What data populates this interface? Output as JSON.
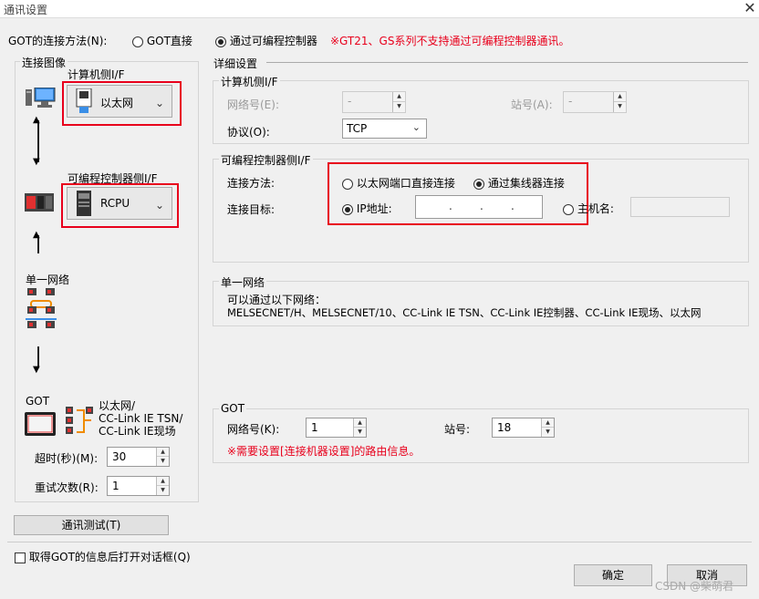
{
  "window": {
    "title": "通讯设置"
  },
  "top": {
    "connection_method_label": "GOT的连接方法(N):",
    "option_direct": "GOT直接",
    "option_plc": "通过可编程控制器",
    "warning": "※GT21、GS系列不支持通过可编程控制器通讯。"
  },
  "left": {
    "image_group": "连接图像",
    "pc_if_label": "计算机侧I/F",
    "pc_if_value": "以太网",
    "plc_if_label": "可编程控制器侧I/F",
    "plc_if_value": "RCPU",
    "network_label": "单一网络",
    "got_label": "GOT",
    "got_net_text": "以太网/\nCC-Link IE TSN/\nCC-Link IE现场",
    "timeout_label": "超时(秒)(M):",
    "timeout_value": "30",
    "retry_label": "重试次数(R):",
    "retry_value": "1",
    "test_button": "通讯测试(T)"
  },
  "detail": {
    "title": "详细设置",
    "pc_if": {
      "title": "计算机侧I/F",
      "network_no_label": "网络号(E):",
      "network_no_value": "-",
      "station_label": "站号(A):",
      "station_value": "-",
      "protocol_label": "协议(O):",
      "protocol_value": "TCP"
    },
    "plc_if": {
      "title": "可编程控制器侧I/F",
      "method_label": "连接方法:",
      "method_direct": "以太网端口直接连接",
      "method_hub": "通过集线器连接",
      "target_label": "连接目标:",
      "ip_label": "IP地址:",
      "host_label": "主机名:"
    },
    "network": {
      "title": "单一网络",
      "desc": "可以通过以下网络：",
      "list": "MELSECNET/H、MELSECNET/10、CC-Link IE TSN、CC-Link IE控制器、CC-Link IE现场、以太网"
    },
    "got": {
      "title": "GOT",
      "network_no_label": "网络号(K):",
      "network_no_value": "1",
      "station_label": "站号:",
      "station_value": "18",
      "note": "※需要设置[连接机器设置]的路由信息。"
    }
  },
  "bottom": {
    "checkbox_label": "取得GOT的信息后打开对话框(Q)",
    "ok": "确定",
    "cancel": "取消",
    "watermark": "CSDN @柴萌君"
  },
  "colors": {
    "warning": "#e8001c",
    "highlight_box": "#e8001c"
  }
}
